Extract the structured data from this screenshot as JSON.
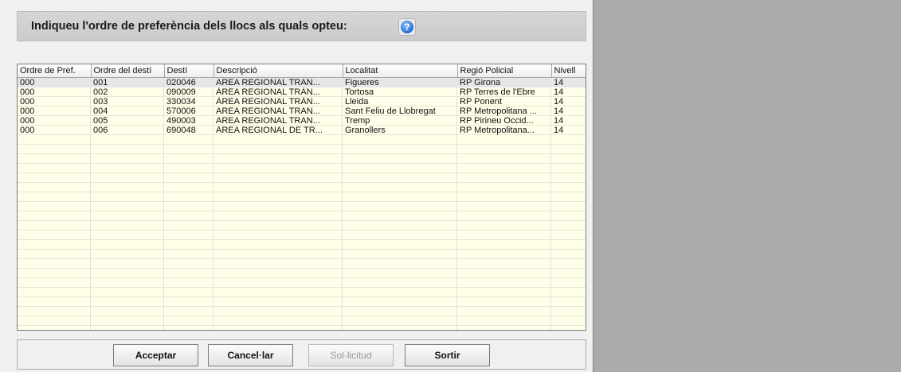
{
  "header": {
    "title": "Indiqueu l'ordre de preferència dels llocs als quals opteu:",
    "help_icon": "?"
  },
  "table": {
    "columns": [
      "Ordre de Pref.",
      "Ordre del destí",
      "Destí",
      "Descripció",
      "Localitat",
      "Regió Policial",
      "Nivell"
    ],
    "rows": [
      [
        "000",
        "001",
        "020046",
        "AREA REGIONAL TRAN...",
        "Figueres",
        "RP Girona",
        "14"
      ],
      [
        "000",
        "002",
        "090009",
        "ÀREA REGIONAL TRÀN...",
        "Tortosa",
        "RP Terres de l'Ebre",
        "14"
      ],
      [
        "000",
        "003",
        "330034",
        "ÀREA REGIONAL TRÀN...",
        "Lleida",
        "RP Ponent",
        "14"
      ],
      [
        "000",
        "004",
        "570006",
        "AREA REGIONAL TRAN...",
        "Sant Feliu de Llobregat",
        "RP Metropolitana ...",
        "14"
      ],
      [
        "000",
        "005",
        "490003",
        "AREA REGIONAL TRAN...",
        "Tremp",
        "RP Pirineu Occid...",
        "14"
      ],
      [
        "000",
        "006",
        "690048",
        "ÀREA REGIONAL DE TR...",
        "Granollers",
        "RP  Metropolitana...",
        "14"
      ]
    ]
  },
  "buttons": {
    "accept": "Acceptar",
    "cancel": "Cancel·lar",
    "request": "Sol·licitud",
    "exit": "Sortir"
  }
}
